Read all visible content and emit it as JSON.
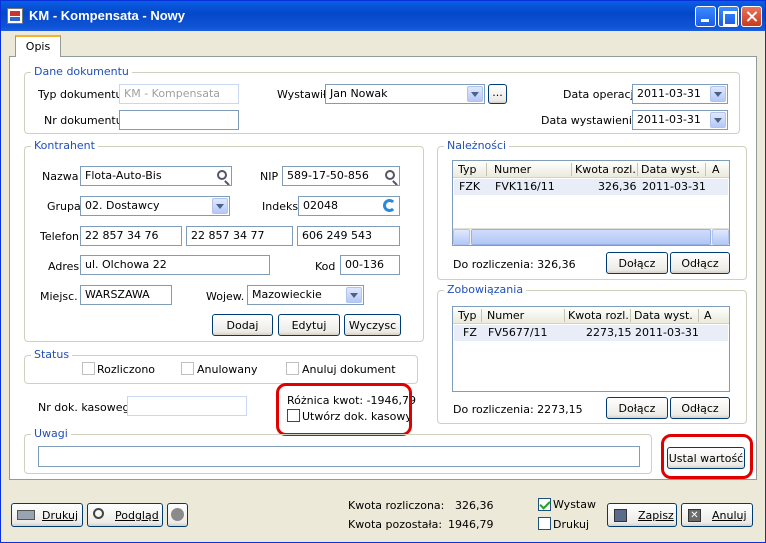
{
  "window": {
    "title": "KM - Kompensata - Nowy"
  },
  "tab": {
    "label": "Opis"
  },
  "dokument": {
    "group_title": "Dane dokumentu",
    "typ_label": "Typ dokumentu",
    "typ_value": "KM - Kompensata",
    "nr_label": "Nr dokumentu",
    "nr_value": "",
    "wystawil_label": "Wystawił",
    "wystawil_value": "Jan Nowak",
    "more_label": "...",
    "data_operacji_label": "Data operacji",
    "data_operacji_value": "2011-03-31",
    "data_wystawienia_label": "Data wystawienia",
    "data_wystawienia_value": "2011-03-31"
  },
  "kontrahent": {
    "group_title": "Kontrahent",
    "nazwa_label": "Nazwa",
    "nazwa_value": "Flota-Auto-Bis",
    "nip_label": "NIP",
    "nip_value": "589-17-50-856",
    "grupa_label": "Grupa",
    "grupa_value": "02. Dostawcy",
    "indeks_label": "Indeks",
    "indeks_value": "02048",
    "telefon_label": "Telefon",
    "telefon_values": [
      "22 857 34 76",
      "22 857 34 77",
      "606 249 543"
    ],
    "adres_label": "Adres",
    "adres_value": "ul. Olchowa 22",
    "kod_label": "Kod",
    "kod_value": "00-136",
    "miejsc_label": "Miejsc.",
    "miejsc_value": "WARSZAWA",
    "wojew_label": "Wojew.",
    "wojew_value": "Mazowieckie",
    "dodaj": "Dodaj",
    "edytuj": "Edytuj",
    "wyczysc": "Wyczysc"
  },
  "naleznosci": {
    "group_title": "Należności",
    "columns": [
      "Typ",
      "Numer",
      "Kwota rozl.",
      "Data wyst.",
      "A"
    ],
    "rows": [
      {
        "typ": "FZK",
        "numer": "FVK116/11",
        "kwota": "326,36",
        "data": "2011-03-31"
      }
    ],
    "do_rozliczenia": "Do rozliczenia: 326,36",
    "dolacz": "Dołącz",
    "odlacz": "Odłącz"
  },
  "zobowiazania": {
    "group_title": "Zobowiązania",
    "columns": [
      "Typ",
      "Numer",
      "Kwota rozl.",
      "Data wyst.",
      "A"
    ],
    "rows": [
      {
        "typ": "FZ",
        "numer": "FV5677/11",
        "kwota": "2273,15",
        "data": "2011-03-31"
      }
    ],
    "do_rozliczenia": "Do rozliczenia: 2273,15",
    "dolacz": "Dołącz",
    "odlacz": "Odłącz"
  },
  "status": {
    "group_title": "Status",
    "rozliczono": "Rozliczono",
    "anulowany": "Anulowany",
    "anuluj_dokument": "Anuluj dokument"
  },
  "kasowy": {
    "nr_label": "Nr dok. kasowego",
    "nr_value": "",
    "roznica": "Różnica kwot: -1946,79",
    "utworz": "Utwórz dok. kasowy"
  },
  "uwagi": {
    "group_title": "Uwagi",
    "value": "",
    "ustal": "Ustal wartość"
  },
  "footer": {
    "drukuj": "Drukuj",
    "podglad": "Podgląd",
    "kwota_rozliczona_label": "Kwota rozliczona:",
    "kwota_rozliczona_value": "326,36",
    "kwota_pozostala_label": "Kwota pozostała:",
    "kwota_pozostala_value": "1946,79",
    "wystaw": "Wystaw",
    "drukuj_chk": "Drukuj",
    "zapisz": "Zapisz",
    "anuluj": "Anuluj"
  },
  "colors": {
    "title_blue": "#0a5fe6",
    "group_title": "#2050b8",
    "highlight": "#e00000"
  }
}
